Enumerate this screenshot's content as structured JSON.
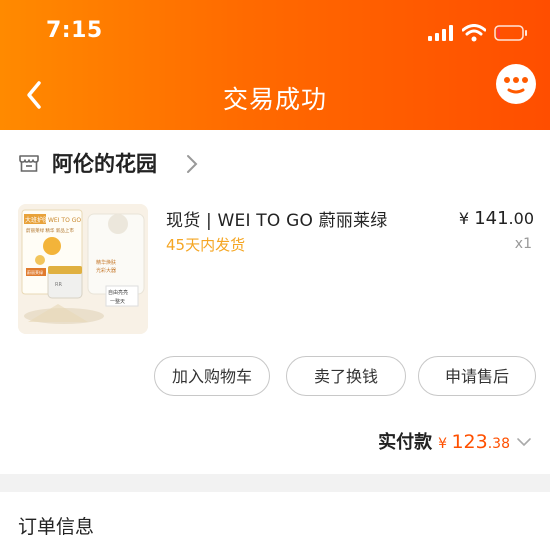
{
  "status_bar": {
    "time": "7:15"
  },
  "nav": {
    "title": "交易成功"
  },
  "store": {
    "name": "阿伦的花园"
  },
  "product": {
    "title": "现货 | WEI TO GO 蔚丽莱绿",
    "shipping": "45天内发货",
    "price_symbol": "¥",
    "price_integer": "141",
    "price_decimal": ".00",
    "quantity": "x1",
    "thumbnail": {
      "brand": "WEI TO GO",
      "banner": "大班护肤",
      "line1": "蔚丽莱绿 精华 新品上市",
      "badge": "蔚丽莱绿",
      "tagline": "自由亮亮",
      "tagline2": "一整天"
    }
  },
  "actions": [
    {
      "label": "加入购物车"
    },
    {
      "label": "卖了换钱"
    },
    {
      "label": "申请售后"
    }
  ],
  "payment": {
    "label": "实付款",
    "symbol": "¥",
    "integer": "123",
    "decimal": ".38"
  },
  "order": {
    "title": "订单信息"
  },
  "colors": {
    "header_start": "#ff8a00",
    "header_end": "#ff4e00",
    "price_accent": "#ff5000",
    "shipping_text": "#f5a623"
  }
}
